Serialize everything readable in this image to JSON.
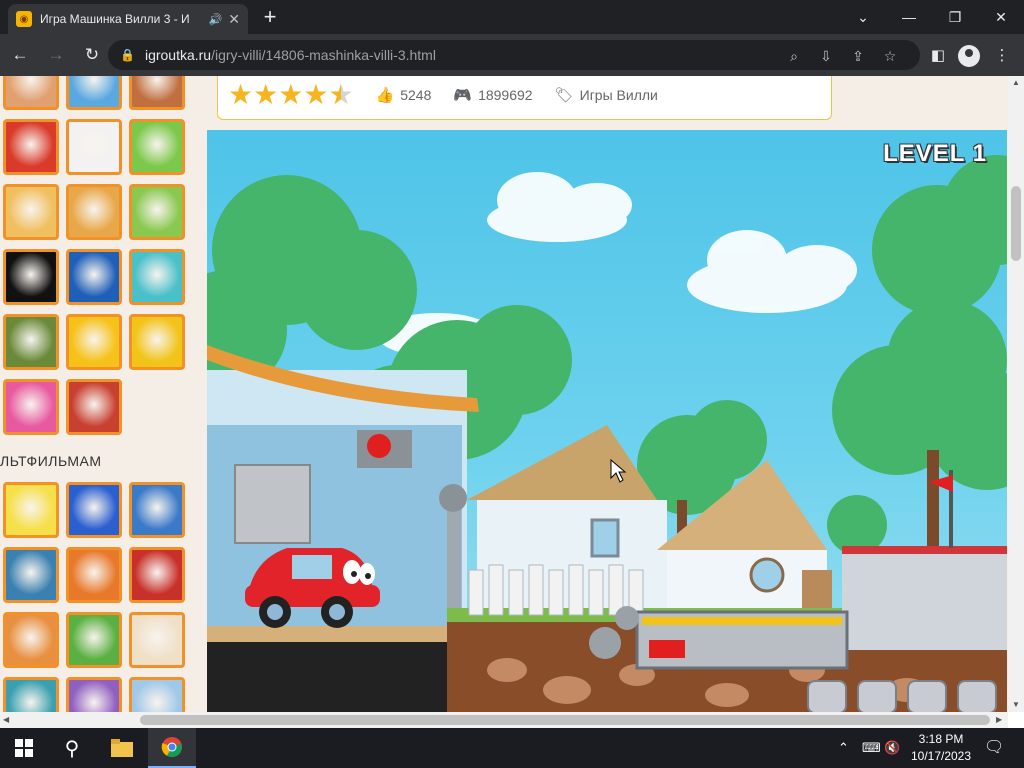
{
  "browser": {
    "tab_title": "Игра Машинка Вилли 3 - И",
    "address": {
      "host": "igroutka.ru",
      "path": "/igry-villi/14806-mashinka-villi-3.html"
    }
  },
  "page": {
    "section_title": "ЛЬТФИЛЬМАМ",
    "rating": {
      "stars": 4.5,
      "max": 5
    },
    "likes": "5248",
    "plays": "1899692",
    "category": "Игры Вилли"
  },
  "game": {
    "level_label": "LEVEL 1"
  },
  "thumbnails_top": [
    {
      "name": "man-face",
      "color": "#e0a070"
    },
    {
      "name": "blue-3d",
      "color": "#5aa8e0"
    },
    {
      "name": "cowboy",
      "color": "#c07040"
    },
    {
      "name": "angry-bird",
      "color": "#d93a2a"
    },
    {
      "name": "panda",
      "color": "#f2f2f2"
    },
    {
      "name": "cut-the-rope",
      "color": "#7cc84a"
    },
    {
      "name": "cake",
      "color": "#f0c060"
    },
    {
      "name": "adam-eve",
      "color": "#e8a84a"
    },
    {
      "name": "wheely-car",
      "color": "#8ac850"
    },
    {
      "name": "cartoon-network",
      "color": "#111111"
    },
    {
      "name": "disney-channel",
      "color": "#1e5fb8"
    },
    {
      "name": "candy-match",
      "color": "#4ac0c8"
    },
    {
      "name": "tank",
      "color": "#6a8a3a"
    },
    {
      "name": "emoji",
      "color": "#f6c21a"
    },
    {
      "name": "among-us",
      "color": "#f2c41a"
    },
    {
      "name": "pop-it",
      "color": "#e85aa0"
    },
    {
      "name": "angry-face",
      "color": "#c84030"
    }
  ],
  "thumbnails_bottom": [
    {
      "name": "spongebob",
      "color": "#f6e04a"
    },
    {
      "name": "sonic",
      "color": "#2a5fd0"
    },
    {
      "name": "paw-patrol",
      "color": "#3a7ac8"
    },
    {
      "name": "gravity-falls",
      "color": "#3a80b0"
    },
    {
      "name": "tom-jerry",
      "color": "#e8782a"
    },
    {
      "name": "cars",
      "color": "#c8302a"
    },
    {
      "name": "naruto",
      "color": "#e89040"
    },
    {
      "name": "scooby-doo",
      "color": "#5ab040"
    },
    {
      "name": "rabbit",
      "color": "#f0e0c8"
    },
    {
      "name": "agent-p",
      "color": "#3aa0b0"
    },
    {
      "name": "equestria",
      "color": "#9060c0"
    },
    {
      "name": "frozen",
      "color": "#a0c8e8"
    }
  ],
  "taskbar": {
    "time": "3:18 PM",
    "date": "10/17/2023"
  }
}
